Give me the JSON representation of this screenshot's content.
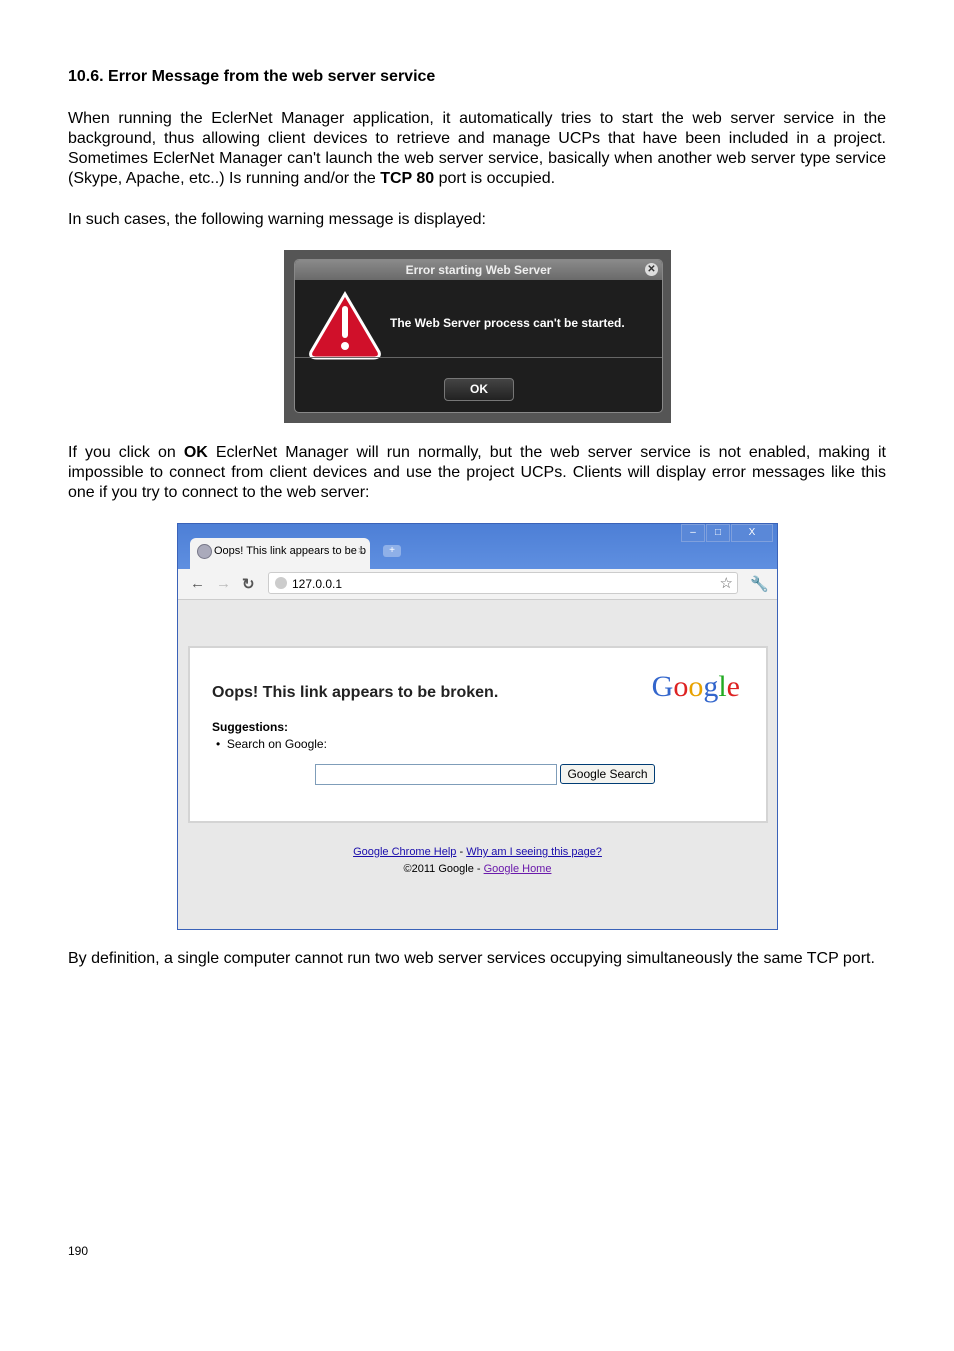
{
  "heading": "10.6. Error Message from the web server service",
  "para1_a": "When running the EclerNet Manager application, it automatically tries to start  the web server service in the background, thus allowing client devices to retrieve and manage UCPs that have been included in a project. Sometimes EclerNet Manager can't launch the web server service, basically when another web server type service (Skype, Apache, etc..) Is running and/or the ",
  "para1_bold": "TCP 80",
  "para1_b": " port is occupied.",
  "para2": "In such cases, the following warning message is displayed:",
  "dialog": {
    "title": "Error starting Web Server",
    "message": "The Web Server process can't be started.",
    "ok": "OK"
  },
  "para3_a": "If you click on ",
  "para3_bold": "OK",
  "para3_b": " EclerNet Manager will run normally, but the web server service is not enabled, making it impossible to connect from client devices and use the project UCPs. Clients will display error messages like this one if you try to connect to the web server:",
  "browser": {
    "tab": "Oops! This link appears to be b",
    "address": "127.0.0.1",
    "title": "Oops! This link appears to be broken.",
    "logo": "Google",
    "suggestions": "Suggestions:",
    "item": "Search on Google:",
    "search_button": "Google Search",
    "link_help": "Google Chrome Help",
    "dash": " - ",
    "link_why": "Why am I seeing this page?",
    "copyright": "©2011 Google - ",
    "link_home": "Google Home"
  },
  "para4": "By definition, a single computer cannot run two web server services occupying simultaneously the same TCP port.",
  "page_number": "190"
}
